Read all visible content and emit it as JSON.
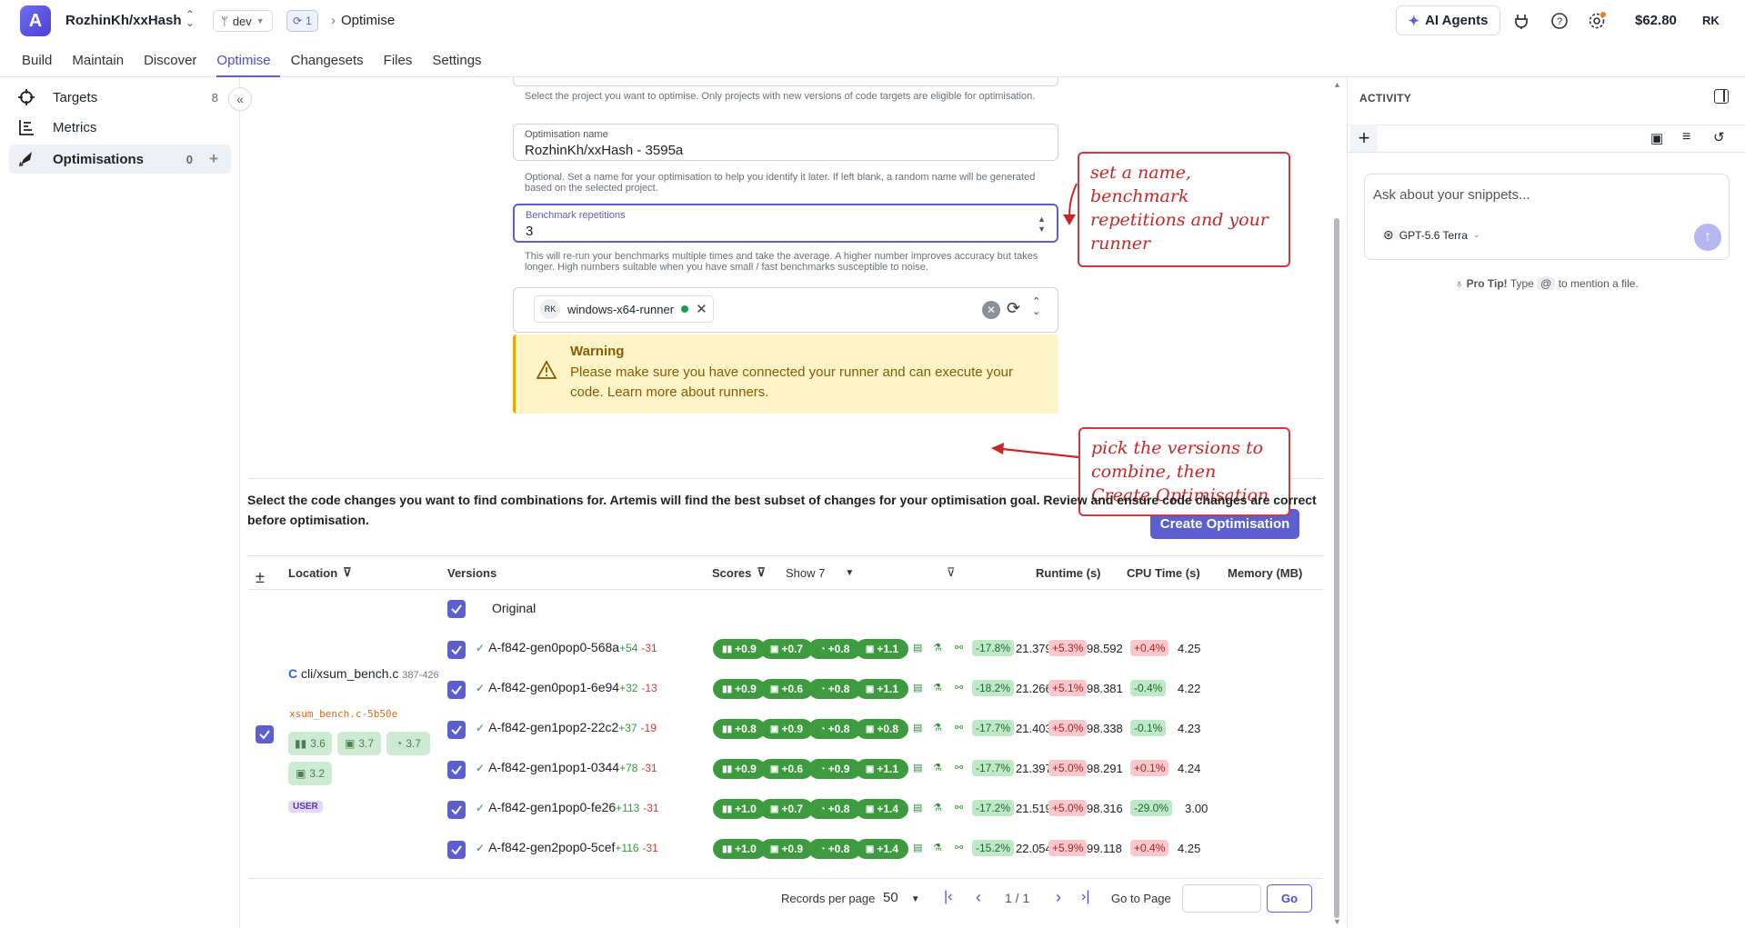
{
  "header": {
    "repo": "RozhinKh/xxHash",
    "branch": "dev",
    "sync_count": "1",
    "crumb": "Optimise",
    "ai_agents": "AI Agents",
    "credits": "$62.80",
    "user_initials": "RK"
  },
  "nav": {
    "tabs": [
      "Build",
      "Maintain",
      "Discover",
      "Optimise",
      "Changesets",
      "Files",
      "Settings"
    ],
    "active": "Optimise"
  },
  "sidebar": {
    "items": [
      {
        "label": "Targets",
        "count": "8"
      },
      {
        "label": "Metrics",
        "count": ""
      },
      {
        "label": "Optimisations",
        "count": "0"
      }
    ]
  },
  "form": {
    "project_help": "Select the project you want to optimise. Only projects with new versions of code targets are eligible for optimisation.",
    "name_label": "Optimisation name",
    "name_value": "RozhinKh/xxHash - 3595a",
    "name_help": "Optional. Set a name for your optimisation to help you identify it later. If left blank, a random name will be generated based on the selected project.",
    "reps_label": "Benchmark repetitions",
    "reps_value": "3",
    "reps_help": "This will re-run your benchmarks multiple times and take the average. A higher number improves accuracy but takes longer. High numbers suitable when you have small / fast benchmarks susceptible to noise.",
    "runner_initials": "RK",
    "runner_name": "windows-x64-runner",
    "warning_title": "Warning",
    "warning_body": "Please make sure you have connected your runner and can execute your code. Learn more about runners.",
    "create_button": "Create Optimisation"
  },
  "annotations": {
    "a1": "set a name, benchmark repetitions and your runner",
    "a2": "pick the versions to combine, then Create Optimisation"
  },
  "description": "Select the code changes you want to find combinations for. Artemis will find the best subset of changes for your optimisation goal. Review and ensure code changes are correct before optimisation.",
  "table": {
    "headers": {
      "location": "Location",
      "versions": "Versions",
      "scores": "Scores",
      "show": "Show 7",
      "runtime": "Runtime (s)",
      "cpu": "CPU Time (s)",
      "memory": "Memory (MB)"
    },
    "original": "Original",
    "location": {
      "file": "cli/xsum_bench.c",
      "lines": "387-426",
      "snippet": "xsum_bench.c-5b50e",
      "scores": [
        "3.6",
        "3.7",
        "3.7",
        "3.2"
      ],
      "tag": "USER"
    },
    "rows": [
      {
        "name": "A-f842-gen0pop0-568a",
        "add": "+54",
        "del": "-31",
        "scores": [
          "+0.9",
          "+0.7",
          "+0.8",
          "+1.1"
        ],
        "rt_d": "-17.8%",
        "rt": "21.379",
        "cpu_d": "+5.3%",
        "cpu": "98.592",
        "mem_d": "+0.4%",
        "mem": "4.25",
        "rt_g": true,
        "cpu_g": false,
        "mem_g": false
      },
      {
        "name": "A-f842-gen0pop1-6e94",
        "add": "+32",
        "del": "-13",
        "scores": [
          "+0.9",
          "+0.6",
          "+0.8",
          "+1.1"
        ],
        "rt_d": "-18.2%",
        "rt": "21.266",
        "cpu_d": "+5.1%",
        "cpu": "98.381",
        "mem_d": "-0.4%",
        "mem": "4.22",
        "rt_g": true,
        "cpu_g": false,
        "mem_g": true
      },
      {
        "name": "A-f842-gen1pop2-22c2",
        "add": "+37",
        "del": "-19",
        "scores": [
          "+0.8",
          "+0.9",
          "+0.8",
          "+0.8"
        ],
        "rt_d": "-17.7%",
        "rt": "21.403",
        "cpu_d": "+5.0%",
        "cpu": "98.338",
        "mem_d": "-0.1%",
        "mem": "4.23",
        "rt_g": true,
        "cpu_g": false,
        "mem_g": true
      },
      {
        "name": "A-f842-gen1pop1-0344",
        "add": "+78",
        "del": "-31",
        "scores": [
          "+0.9",
          "+0.6",
          "+0.9",
          "+1.1"
        ],
        "rt_d": "-17.7%",
        "rt": "21.397",
        "cpu_d": "+5.0%",
        "cpu": "98.291",
        "mem_d": "+0.1%",
        "mem": "4.24",
        "rt_g": true,
        "cpu_g": false,
        "mem_g": false
      },
      {
        "name": "A-f842-gen1pop0-fe26",
        "add": "+113",
        "del": "-31",
        "scores": [
          "+1.0",
          "+0.7",
          "+0.8",
          "+1.4"
        ],
        "rt_d": "-17.2%",
        "rt": "21.519",
        "cpu_d": "+5.0%",
        "cpu": "98.316",
        "mem_d": "-29.0%",
        "mem": "3.00",
        "rt_g": true,
        "cpu_g": false,
        "mem_g": true
      },
      {
        "name": "A-f842-gen2pop0-5cef",
        "add": "+116",
        "del": "-31",
        "scores": [
          "+1.0",
          "+0.9",
          "+0.8",
          "+1.4"
        ],
        "rt_d": "-15.2%",
        "rt": "22.054",
        "cpu_d": "+5.9%",
        "cpu": "99.118",
        "mem_d": "+0.4%",
        "mem": "4.25",
        "rt_g": true,
        "cpu_g": false,
        "mem_g": false
      }
    ]
  },
  "pager": {
    "records_label": "Records per page",
    "records_value": "50",
    "page": "1 / 1",
    "goto_label": "Go to Page",
    "go": "Go"
  },
  "activity": {
    "title": "ACTIVITY",
    "placeholder": "Ask about your snippets...",
    "model": "GPT-5.6 Terra",
    "tip_bold": "Pro Tip!",
    "tip_text": "Type",
    "tip_key": "@",
    "tip_rest": "to mention a file."
  }
}
